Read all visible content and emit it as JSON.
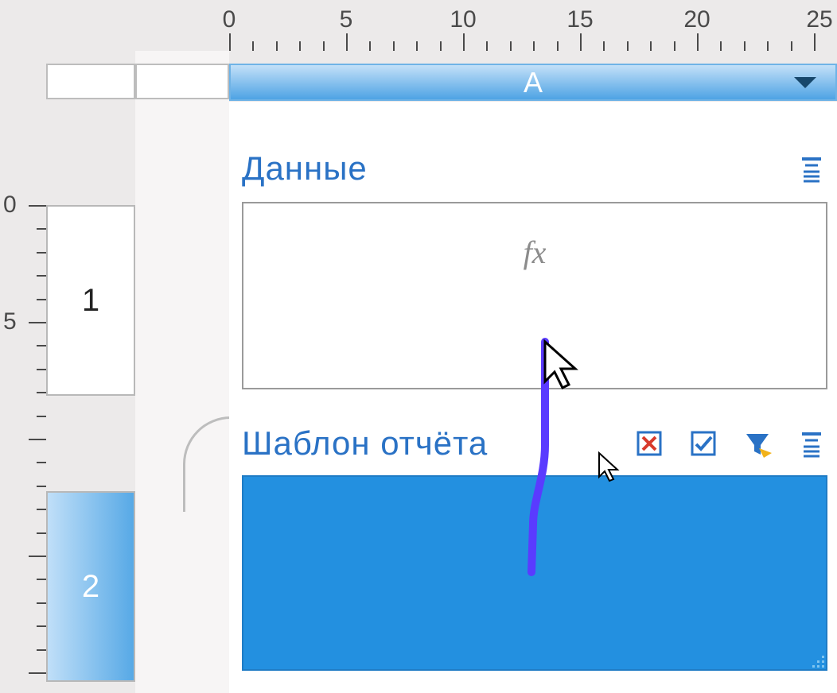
{
  "ruler": {
    "h_labels": [
      "0",
      "5",
      "10",
      "15",
      "20",
      "25"
    ],
    "v_labels": [
      "0",
      "5"
    ]
  },
  "rows": [
    {
      "label": "1",
      "selected": false
    },
    {
      "label": "2",
      "selected": true
    }
  ],
  "column": {
    "label": "A"
  },
  "sections": {
    "data": {
      "title": "Данные",
      "formula_placeholder": "fx"
    },
    "template": {
      "title": "Шаблон отчёта"
    }
  },
  "icons": {
    "expand": "expand-icon",
    "delete": "delete-icon",
    "check": "check-icon",
    "filter": "filter-icon"
  }
}
